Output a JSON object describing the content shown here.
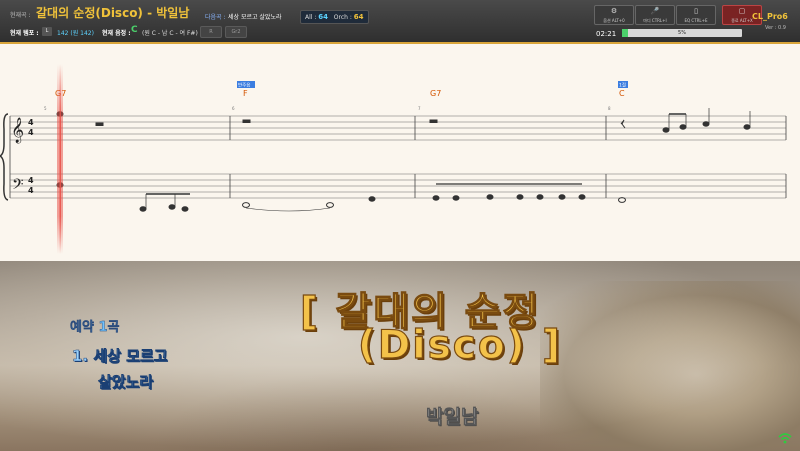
{
  "header": {
    "now_label": "현재곡 :",
    "now_title": "갈대의 순정(Disco)  -  박일남",
    "next_label": "다음곡 :",
    "next_title": "세상 모르고 살았노라",
    "all_label": "All :",
    "all_value": "64",
    "orch_label": "Orch :",
    "orch_value": "64",
    "tempo_label": "현재 템포 :",
    "tempo_key": "L",
    "tempo_value": "142 (원 142)",
    "key_label": "현재 음정 :",
    "key_value": "C",
    "key_desc": "(원 C - 남 C - 여 F#)",
    "btn_a": "R",
    "btn_b": "Gr2",
    "time": "02:21",
    "progress_percent": 5,
    "progress_text": "5%",
    "controls": [
      {
        "icon": "gear-icon",
        "glyph": "⚙",
        "label": "옵션 ALT+0"
      },
      {
        "icon": "mic-icon",
        "glyph": "🎤",
        "label": "마디 CTRL+I"
      },
      {
        "icon": "eq-icon",
        "glyph": "▯",
        "label": "EQ CTRL+E"
      },
      {
        "icon": "exit-icon",
        "glyph": "▢",
        "label": "종료 ALT+X"
      }
    ],
    "brand": "CL_Pro6",
    "version": "Ver : 0.9"
  },
  "score": {
    "chords": [
      "G7",
      "F",
      "G7",
      "C"
    ],
    "chord_tags": [
      "",
      "반주음",
      "",
      "1절"
    ],
    "measure_numbers": [
      "5",
      "6",
      "7",
      "8"
    ],
    "time_signature": "4/4"
  },
  "video": {
    "queue_label": "예약 1곡",
    "queue_item_line1": "1. 세상 모르고",
    "queue_item_line2": "살았노라",
    "title_line1": "[ 갈대의 순정",
    "title_line2": "(Disco) ]",
    "artist": "박일남"
  },
  "colors": {
    "accent": "#f0c23a",
    "progress": "#4bd16b",
    "playhead": "#e8524a",
    "chord": "#d35400"
  }
}
